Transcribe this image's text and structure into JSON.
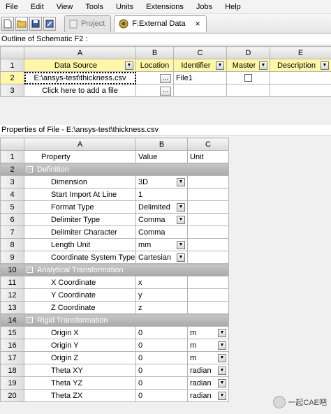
{
  "menu": [
    "File",
    "Edit",
    "View",
    "Tools",
    "Units",
    "Extensions",
    "Jobs",
    "Help"
  ],
  "tabs": [
    {
      "label": "Project",
      "active": false
    },
    {
      "label": "F:External Data",
      "active": true
    }
  ],
  "tab_close": "×",
  "outline": {
    "title": "Outline of Schematic F2 :",
    "columns": [
      "A",
      "B",
      "C",
      "D",
      "E"
    ],
    "headers": [
      "Data Source",
      "Location",
      "Identifier",
      "Master",
      "Description"
    ],
    "rows": [
      {
        "num": "1"
      },
      {
        "num": "2",
        "source": "E:\\ansys-test\\thickness.csv",
        "location_btn": "...",
        "identifier": "File1"
      },
      {
        "num": "3",
        "source": "Click here to add a file",
        "location_btn": "..."
      }
    ]
  },
  "props": {
    "title": "Properties of File - E:\\ansys-test\\thickness.csv",
    "columns": [
      "A",
      "B",
      "C"
    ],
    "headers": [
      "Property",
      "Value",
      "Unit"
    ],
    "rows": [
      {
        "num": "2",
        "section": "Definition"
      },
      {
        "num": "3",
        "prop": "Dimension",
        "value": "3D",
        "value_dd": true
      },
      {
        "num": "4",
        "prop": "Start Import At Line",
        "value": "1"
      },
      {
        "num": "5",
        "prop": "Format Type",
        "value": "Delimited",
        "value_dd": true
      },
      {
        "num": "6",
        "prop": "Delimiter Type",
        "value": "Comma",
        "value_dd": true
      },
      {
        "num": "7",
        "prop": "Delimiter Character",
        "value": "Comma"
      },
      {
        "num": "8",
        "prop": "Length Unit",
        "value": "mm",
        "value_dd": true
      },
      {
        "num": "9",
        "prop": "Coordinate System Type",
        "value": "Cartesian",
        "value_dd": true
      },
      {
        "num": "10",
        "section": "Analytical Transformation"
      },
      {
        "num": "11",
        "prop": "X Coordinate",
        "value": "x"
      },
      {
        "num": "12",
        "prop": "Y Coordinate",
        "value": "y"
      },
      {
        "num": "13",
        "prop": "Z Coordinate",
        "value": "z"
      },
      {
        "num": "14",
        "section": "Rigid Transformation"
      },
      {
        "num": "15",
        "prop": "Origin X",
        "value": "0",
        "unit": "m"
      },
      {
        "num": "16",
        "prop": "Origin Y",
        "value": "0",
        "unit": "m"
      },
      {
        "num": "17",
        "prop": "Origin Z",
        "value": "0",
        "unit": "m"
      },
      {
        "num": "18",
        "prop": "Theta XY",
        "value": "0",
        "unit": "radian"
      },
      {
        "num": "19",
        "prop": "Theta YZ",
        "value": "0",
        "unit": "radian"
      },
      {
        "num": "20",
        "prop": "Theta ZX",
        "value": "0",
        "unit": "radian"
      }
    ]
  },
  "watermark": "一起CAE吧"
}
